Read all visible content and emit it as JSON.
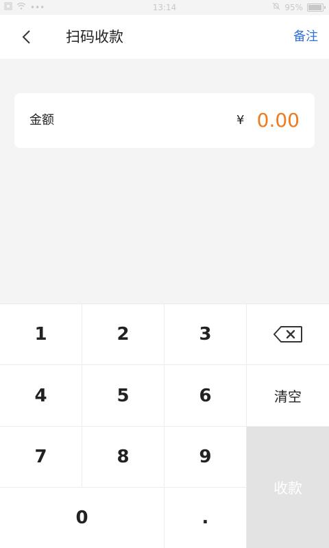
{
  "status_bar": {
    "time": "13:14",
    "battery_text": "95%",
    "battery_level": 0.95,
    "left_icons": [
      "sim-icon",
      "wifi-icon",
      "more-dots-icon"
    ],
    "right_icons": [
      "mute-icon",
      "battery-icon"
    ]
  },
  "nav": {
    "title": "扫码收款",
    "note_label": "备注",
    "back_icon": "chevron-left-icon"
  },
  "amount": {
    "label": "金额",
    "currency": "¥",
    "value": "0.00",
    "value_color": "#f07a1c"
  },
  "keypad": {
    "keys": [
      "1",
      "2",
      "3",
      "4",
      "5",
      "6",
      "7",
      "8",
      "9",
      "0",
      "."
    ],
    "backspace_icon": "backspace-icon",
    "clear_label": "清空",
    "submit_label": "收款"
  },
  "colors": {
    "accent": "#2f6fd6",
    "amount": "#f07a1c",
    "submit_bg": "#e3e3e3"
  }
}
